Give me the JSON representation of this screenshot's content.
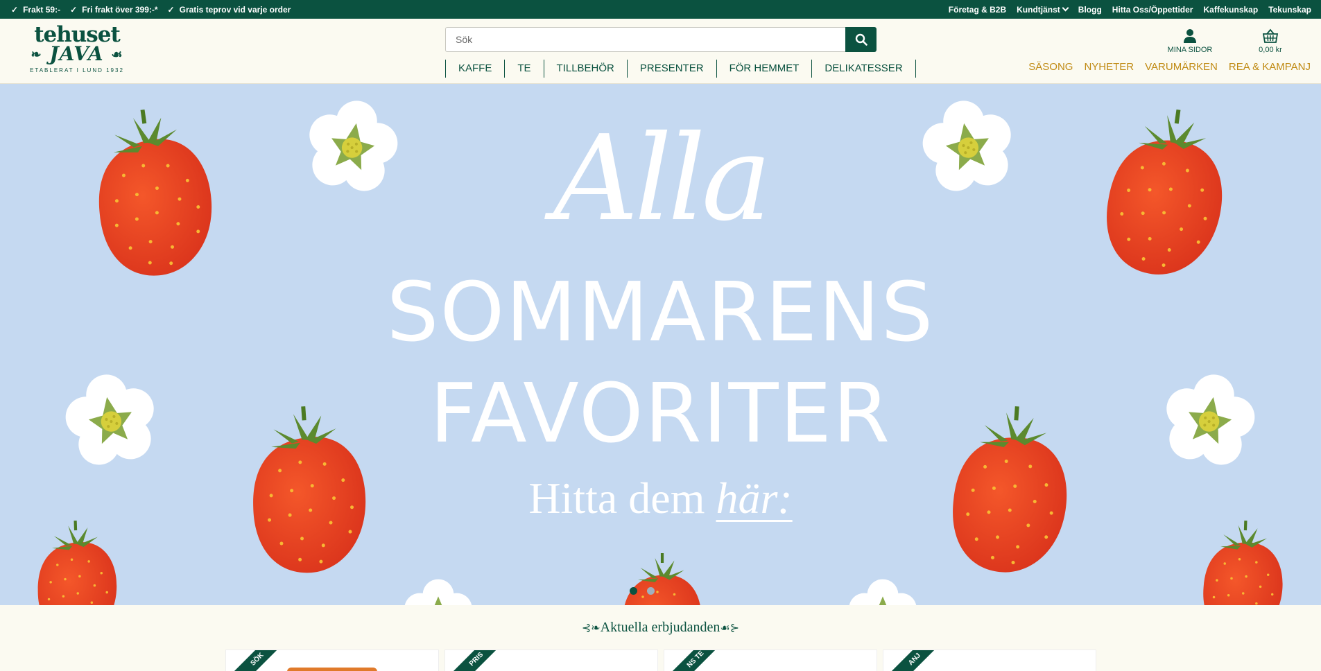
{
  "topbar": {
    "usps": [
      "Frakt 59:-",
      "Fri frakt över 399:-*",
      "Gratis teprov vid varje order"
    ],
    "links": [
      "Företag & B2B",
      "Kundtjänst",
      "Blogg",
      "Hitta Oss/Öppettider",
      "Kaffekunskap",
      "Tekunskap"
    ]
  },
  "logo": {
    "line1": "tehuset",
    "line2": "JAVA",
    "tagline": "ETABLERAT I LUND 1932"
  },
  "search": {
    "placeholder": "Sök",
    "value": ""
  },
  "main_nav": [
    "KAFFE",
    "TE",
    "TILLBEHÖR",
    "PRESENTER",
    "FÖR HEMMET",
    "DELIKATESSER"
  ],
  "account": {
    "label": "MINA SIDOR"
  },
  "cart": {
    "total": "0,00 kr"
  },
  "secondary_nav": [
    "SÄSONG",
    "NYHETER",
    "VARUMÄRKEN",
    "REA & KAMPANJ"
  ],
  "hero": {
    "script": "Alla",
    "line1": "SOMMARENS",
    "line2": "FAVORITER",
    "cta_prefix": "Hitta dem ",
    "cta_emph": "här:",
    "slides": 2,
    "active_slide": 1
  },
  "offers": {
    "title": "Aktuella erbjudanden",
    "cards": [
      {
        "ribbon": "SÖK"
      },
      {
        "ribbon": "PRIS"
      },
      {
        "ribbon": "NS TE"
      },
      {
        "ribbon": "ANJ"
      }
    ]
  },
  "colors": {
    "brand": "#0b5240",
    "accent": "#c08a13",
    "hero_bg": "#c5d9f1"
  }
}
